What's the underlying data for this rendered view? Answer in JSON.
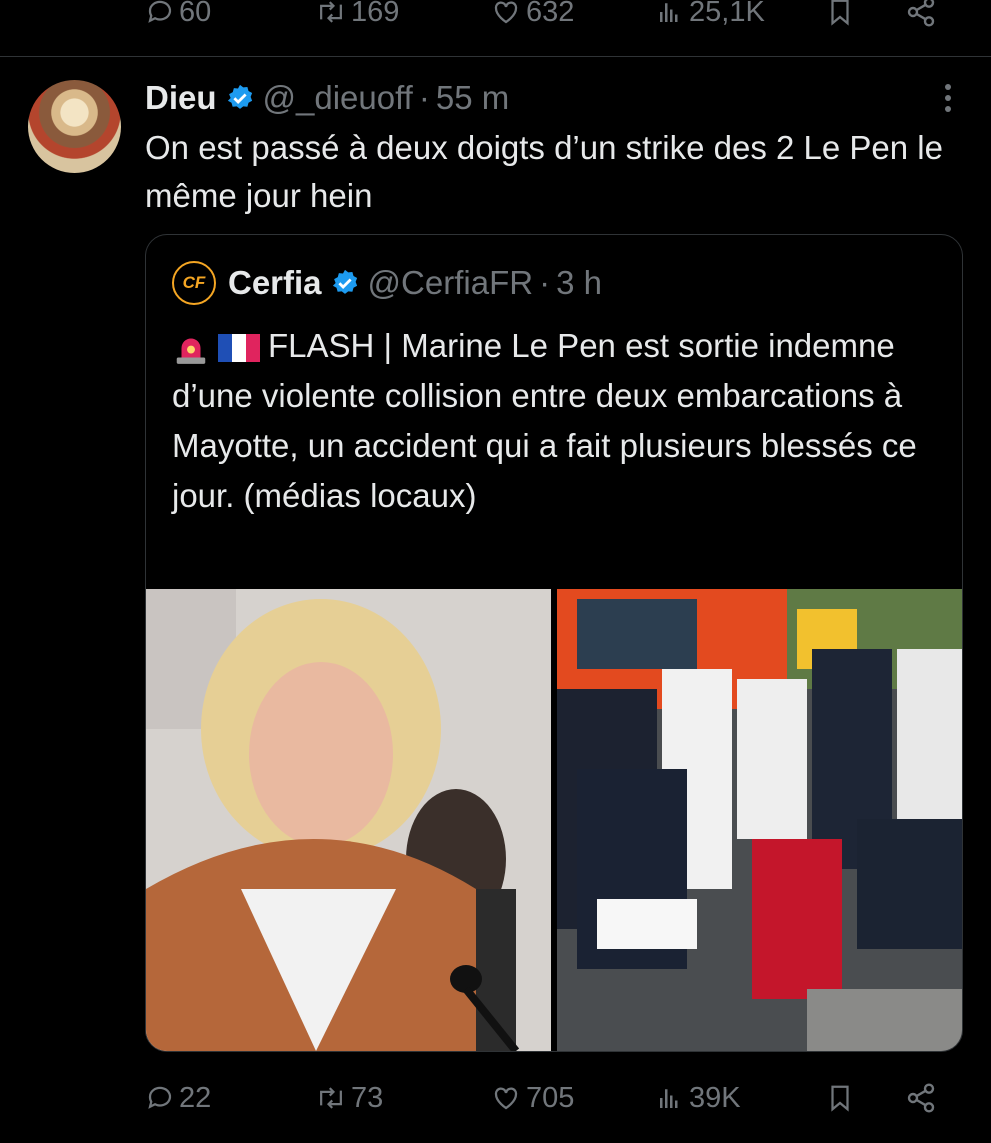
{
  "top_actions": {
    "replies": "60",
    "retweets": "169",
    "likes": "632",
    "views": "25,1K"
  },
  "tweet": {
    "name": "Dieu",
    "handle": "@_dieuoff",
    "separator": "·",
    "time": "55 m",
    "text": "On est passé à deux doigts d’un strike des 2 Le Pen le même jour hein"
  },
  "quote": {
    "name": "Cerfia",
    "handle": "@CerfiaFR",
    "separator": "·",
    "time": "3 h",
    "avatar_text": "CF",
    "text": "FLASH | Marine Le Pen est sortie indemne d’une violente collision entre deux embarcations à Mayotte, un accident qui a fait plusieurs blessés ce jour. (médias locaux)"
  },
  "bottom_actions": {
    "replies": "22",
    "retweets": "73",
    "likes": "705",
    "views": "39K"
  },
  "colors": {
    "background": "#000000",
    "text": "#e7e9ea",
    "muted": "#71767b",
    "verified": "#1d9bf0",
    "cerfia_orange": "#f5a623"
  },
  "icons": [
    "reply-icon",
    "retweet-icon",
    "like-icon",
    "views-icon",
    "bookmark-icon",
    "share-icon",
    "verified-icon",
    "more-icon",
    "siren-icon",
    "france-flag-icon"
  ]
}
